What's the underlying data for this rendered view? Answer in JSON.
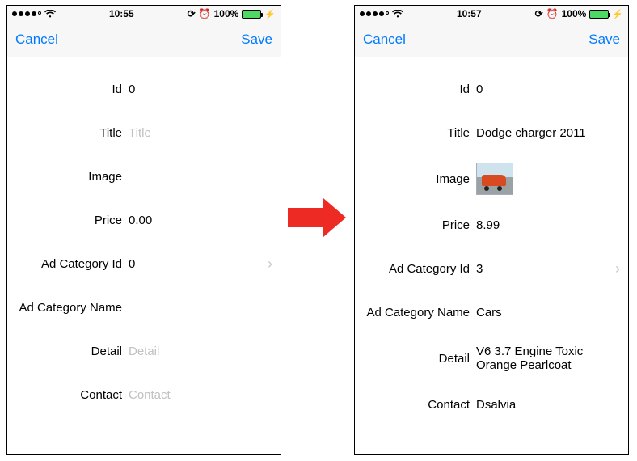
{
  "status": {
    "battery_pct": "100%"
  },
  "nav": {
    "cancel": "Cancel",
    "save": "Save"
  },
  "labels": {
    "id": "Id",
    "title": "Title",
    "image": "Image",
    "price": "Price",
    "ad_cat_id": "Ad Category Id",
    "ad_cat_name": "Ad Category Name",
    "detail": "Detail",
    "contact": "Contact"
  },
  "placeholders": {
    "title": "Title",
    "detail": "Detail",
    "contact": "Contact"
  },
  "left": {
    "time": "10:55",
    "id": "0",
    "title": "",
    "price": "0.00",
    "ad_cat_id": "0",
    "ad_cat_name": "",
    "detail": "",
    "contact": ""
  },
  "right": {
    "time": "10:57",
    "id": "0",
    "title": "Dodge charger 2011",
    "price": "8.99",
    "ad_cat_id": "3",
    "ad_cat_name": "Cars",
    "detail": "V6 3.7 Engine Toxic Orange Pearlcoat",
    "contact": "Dsalvia"
  }
}
